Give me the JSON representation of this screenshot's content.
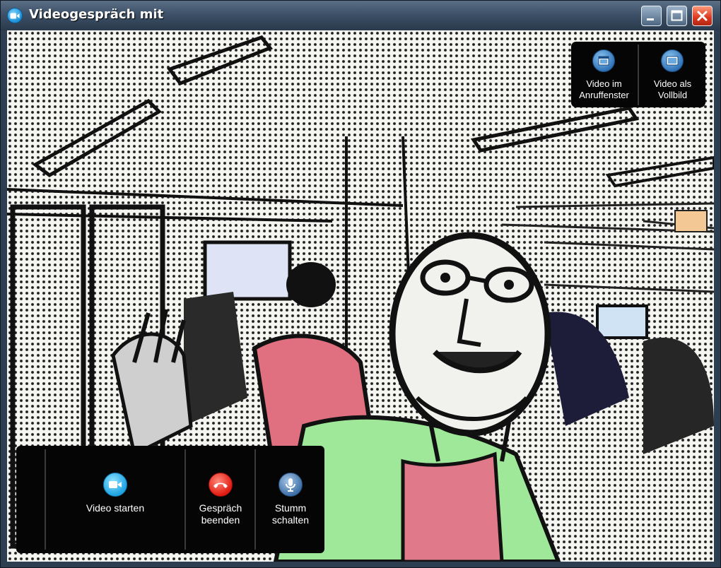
{
  "window": {
    "title": "Videogespräch mit",
    "icons": {
      "app": "video-call-icon",
      "minimize": "minimize-icon",
      "maximize": "maximize-icon",
      "close": "close-icon"
    }
  },
  "video_view_controls": [
    {
      "label_line1": "Video im",
      "label_line2": "Anruffenster",
      "icon": "windowed-video-icon"
    },
    {
      "label_line1": "Video als",
      "label_line2": "Vollbild",
      "icon": "fullscreen-video-icon"
    }
  ],
  "call_controls": {
    "start_video": {
      "label": "Video starten",
      "icon": "video-camera-icon",
      "color": "#1fa3e3"
    },
    "end_call": {
      "label_line1": "Gespräch",
      "label_line2": "beenden",
      "icon": "hang-up-icon",
      "color": "#e11b12"
    },
    "mute": {
      "label_line1": "Stumm",
      "label_line2": "schalten",
      "icon": "microphone-icon",
      "color": "#3c6ea6"
    }
  }
}
